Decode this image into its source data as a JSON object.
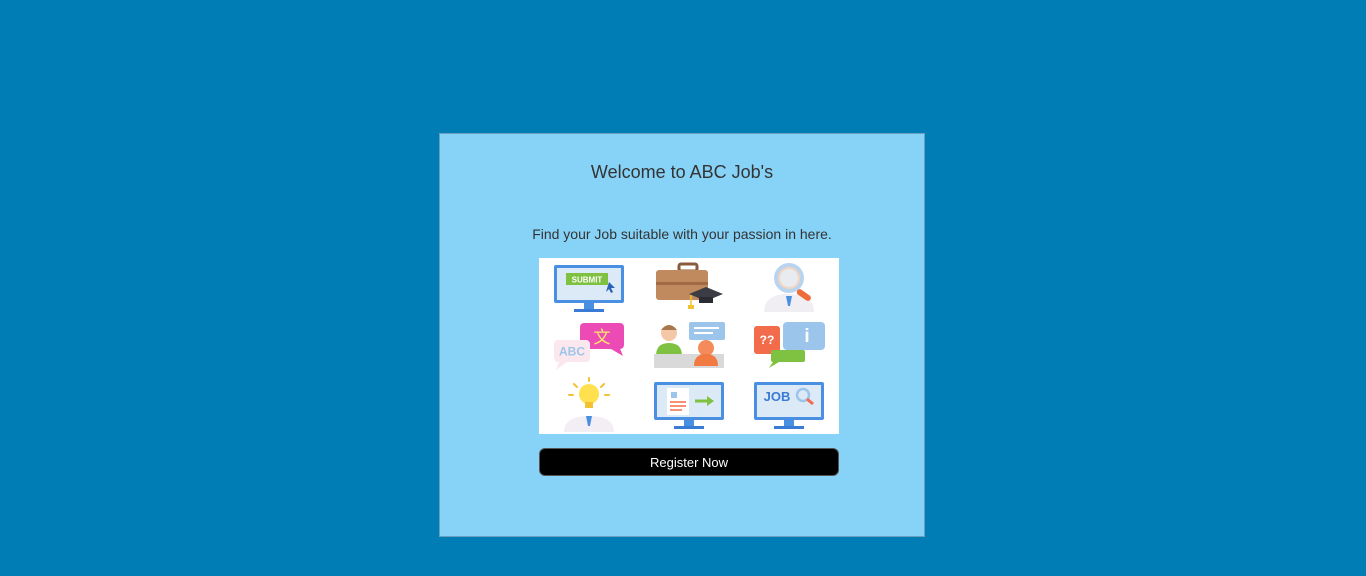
{
  "card": {
    "title": "Welcome to ABC Job's",
    "subtitle": "Find your Job suitable with your passion in here.",
    "register_label": "Register Now"
  },
  "illustration": {
    "icons": [
      {
        "name": "submit-monitor-icon",
        "text": "SUBMIT"
      },
      {
        "name": "briefcase-graduation-icon"
      },
      {
        "name": "person-magnifier-icon"
      },
      {
        "name": "language-translate-icon",
        "text": "ABC",
        "glyph": "文"
      },
      {
        "name": "interview-chat-icon"
      },
      {
        "name": "question-info-chat-icon",
        "text": "??",
        "glyph": "i"
      },
      {
        "name": "lightbulb-idea-icon"
      },
      {
        "name": "resume-monitor-icon"
      },
      {
        "name": "job-search-monitor-icon",
        "text": "JOB"
      }
    ]
  },
  "colors": {
    "page_background": "#017db5",
    "card_background": "#87d3f8",
    "button_background": "#000000",
    "button_text": "#ffffff"
  }
}
